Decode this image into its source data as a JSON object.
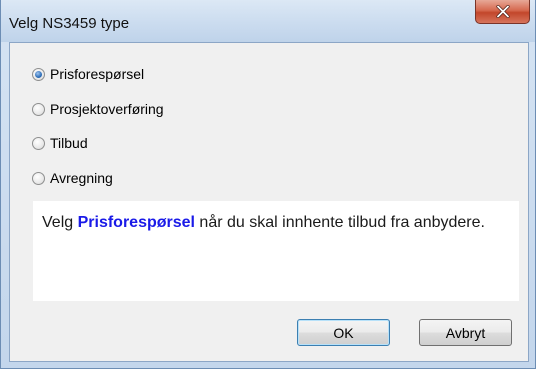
{
  "window": {
    "title": "Velg NS3459 type"
  },
  "options": [
    {
      "label": "Prisforespørsel",
      "checked": true
    },
    {
      "label": "Prosjektoverføring",
      "checked": false
    },
    {
      "label": "Tilbud",
      "checked": false
    },
    {
      "label": "Avregning",
      "checked": false
    }
  ],
  "info": {
    "prefix": "Velg ",
    "highlight": "Prisforespørsel",
    "suffix": " når du skal innhente tilbud fra anbydere.",
    "highlight_color": "#1a1ae8"
  },
  "buttons": {
    "ok_label": "OK",
    "cancel_label": "Avbryt"
  },
  "icons": {
    "close": "close-icon",
    "radio": "radio-button"
  }
}
